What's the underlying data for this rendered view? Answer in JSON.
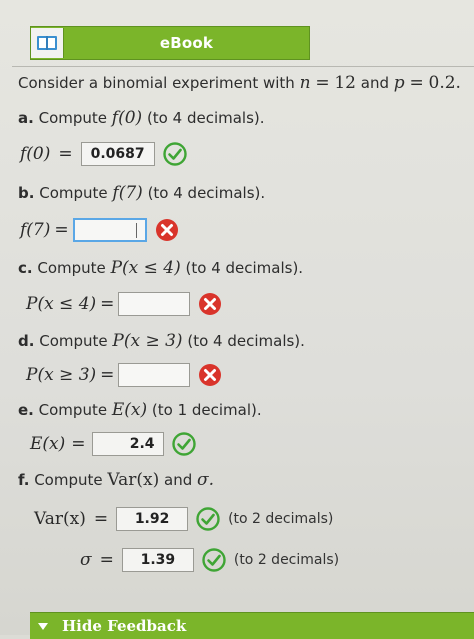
{
  "ebook": {
    "label": "eBook",
    "icon": "book-icon",
    "color": "#7bb52a"
  },
  "intro": {
    "prefix": "Consider a binomial experiment with",
    "n_sym": "n",
    "eq1": "=",
    "n_val": "12",
    "and": "and",
    "p_sym": "p",
    "eq2": "=",
    "p_val": "0.2."
  },
  "parts": {
    "a": {
      "letter": "a.",
      "text": "Compute",
      "expr": "f(0)",
      "suffix": "(to 4 decimals).",
      "lhs": "f(0)",
      "eq": "=",
      "value": "0.0687",
      "status": "correct"
    },
    "b": {
      "letter": "b.",
      "text": "Compute",
      "expr": "f(7)",
      "suffix": "(to 4 decimals).",
      "lhs": "f(7)",
      "eq": "=",
      "value": "",
      "status": "incorrect"
    },
    "c": {
      "letter": "c.",
      "text": "Compute",
      "expr": "P(x ≤ 4)",
      "suffix": "(to 4 decimals).",
      "lhs": "P(x ≤ 4)",
      "eq": "=",
      "value": "",
      "status": "incorrect"
    },
    "d": {
      "letter": "d.",
      "text": "Compute",
      "expr": "P(x ≥ 3)",
      "suffix": "(to 4 decimals).",
      "lhs": "P(x ≥ 3)",
      "eq": "=",
      "value": "",
      "status": "incorrect"
    },
    "e": {
      "letter": "e.",
      "text": "Compute",
      "expr": "E(x)",
      "suffix": "(to 1 decimal).",
      "lhs": "E(x)",
      "eq": "=",
      "value": "2.4",
      "status": "correct"
    },
    "f": {
      "letter": "f.",
      "text": "Compute",
      "expr": "Var(x)",
      "and": "and",
      "sigma": "σ.",
      "var": {
        "lhs": "Var(x)",
        "eq": "=",
        "value": "1.92",
        "status": "correct",
        "note": "(to 2 decimals)"
      },
      "sd": {
        "lhs": "σ",
        "eq": "=",
        "value": "1.39",
        "status": "correct",
        "note": "(to 2 decimals)"
      }
    }
  },
  "feedback": {
    "label": "Hide Feedback"
  },
  "colors": {
    "correct": "#3fa535",
    "incorrect": "#d9342b",
    "bar": "#7bb52a"
  }
}
